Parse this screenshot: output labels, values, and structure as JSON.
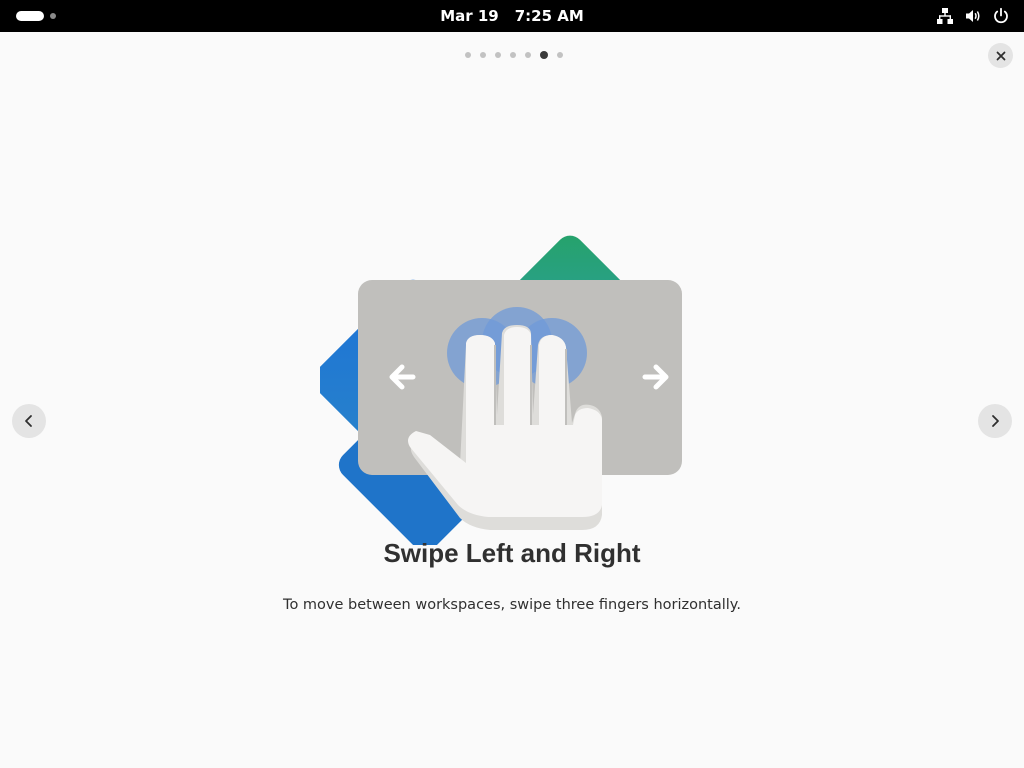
{
  "topbar": {
    "date": "Mar 19",
    "time": "7:25 AM",
    "icons": [
      "network-icon",
      "volume-icon",
      "power-icon"
    ]
  },
  "pager": {
    "total_pages": 7,
    "current_page": 6
  },
  "page": {
    "title": "Swipe Left and Right",
    "description": "To move between workspaces, swipe three fingers horizontally."
  },
  "icons": {
    "close": "close-icon",
    "prev": "chevron-left-icon",
    "next": "chevron-right-icon"
  },
  "colors": {
    "background": "#fafafa",
    "topbar": "#000000",
    "button_bg": "#e4e4e4",
    "touchpad": "#c0bfbc",
    "finger_glow": "#6f9ad8",
    "blue_workspace": "#1c71d8",
    "green_workspace": "#2ec27e"
  }
}
